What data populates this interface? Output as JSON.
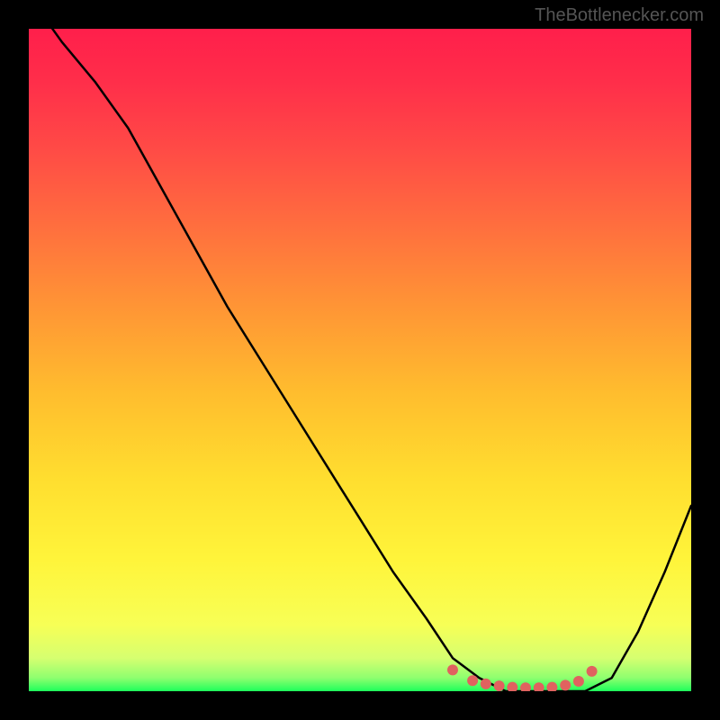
{
  "attribution": "TheBottlenecker.com",
  "chart_data": {
    "type": "line",
    "title": "",
    "xlabel": "",
    "ylabel": "",
    "xlim": [
      0,
      100
    ],
    "ylim": [
      0,
      100
    ],
    "legend": false,
    "grid": false,
    "background": "rainbow-vertical-red-to-green",
    "series": [
      {
        "name": "curve",
        "color": "#000000",
        "x": [
          0,
          5,
          10,
          15,
          20,
          25,
          30,
          35,
          40,
          45,
          50,
          55,
          60,
          64,
          68,
          72,
          76,
          80,
          84,
          88,
          92,
          96,
          100
        ],
        "y": [
          105,
          98,
          92,
          85,
          76,
          67,
          58,
          50,
          42,
          34,
          26,
          18,
          11,
          5,
          2,
          0,
          0,
          0,
          0,
          2,
          9,
          18,
          28
        ]
      },
      {
        "name": "highlight-points",
        "color": "#e0625f",
        "type": "scatter",
        "x": [
          64,
          67,
          69,
          71,
          73,
          75,
          77,
          79,
          81,
          83,
          85
        ],
        "y": [
          3.2,
          1.6,
          1.1,
          0.8,
          0.6,
          0.5,
          0.5,
          0.6,
          0.9,
          1.5,
          3.0
        ]
      }
    ]
  }
}
